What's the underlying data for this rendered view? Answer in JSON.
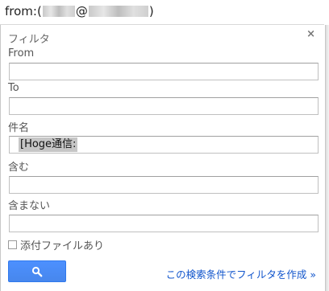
{
  "search": {
    "prefix": "from:(",
    "at": "@",
    "suffix": ")"
  },
  "panel": {
    "title": "フィルタ",
    "close_label": "×"
  },
  "fields": {
    "from": {
      "label": "From",
      "value": ""
    },
    "to": {
      "label": "To",
      "value": ""
    },
    "subject": {
      "label": "件名",
      "value": "[Hoge通信:"
    },
    "has_words": {
      "label": "含む",
      "value": ""
    },
    "doesnt_have": {
      "label": "含まない",
      "value": ""
    }
  },
  "attachment": {
    "label": "添付ファイルあり",
    "checked": false
  },
  "actions": {
    "search_icon": "search-icon",
    "create_filter_link": "この検索条件でフィルタを作成 »"
  },
  "colors": {
    "accent_button": "#4d90fe",
    "link": "#1155cc"
  }
}
